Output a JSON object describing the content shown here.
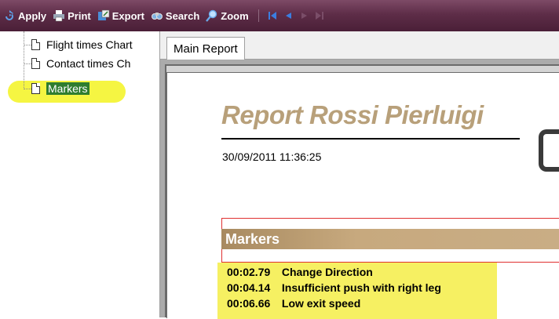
{
  "toolbar": {
    "items": [
      {
        "label": "Apply",
        "icon": "apply-icon"
      },
      {
        "label": "Print",
        "icon": "print-icon"
      },
      {
        "label": "Export",
        "icon": "export-icon"
      },
      {
        "label": "Search",
        "icon": "search-icon"
      },
      {
        "label": "Zoom",
        "icon": "zoom-icon"
      }
    ],
    "nav_icons": [
      "first-page-icon",
      "prev-page-icon",
      "next-page-icon",
      "last-page-icon"
    ]
  },
  "tree": {
    "items": [
      {
        "label": "Flight times Chart"
      },
      {
        "label": "Contact times Ch"
      },
      {
        "label": "Markers"
      }
    ],
    "selected": "Markers"
  },
  "tabs": [
    {
      "label": "Main Report"
    }
  ],
  "report": {
    "title": "Report Rossi Pierluigi",
    "date": "30/09/2011  11:36:25",
    "section_title": "Markers",
    "markers": [
      {
        "time": "00:02.79",
        "label": "Change Direction"
      },
      {
        "time": "00:04.14",
        "label": "Insufficient push with right leg"
      },
      {
        "time": "00:06.66",
        "label": "Low exit speed"
      }
    ]
  },
  "colors": {
    "toolbar": "#5e2d48",
    "highlight": "#f5f542",
    "title": "#b8a07a",
    "section_bar": "#b89a6e",
    "marker_box": "#f6f062"
  }
}
